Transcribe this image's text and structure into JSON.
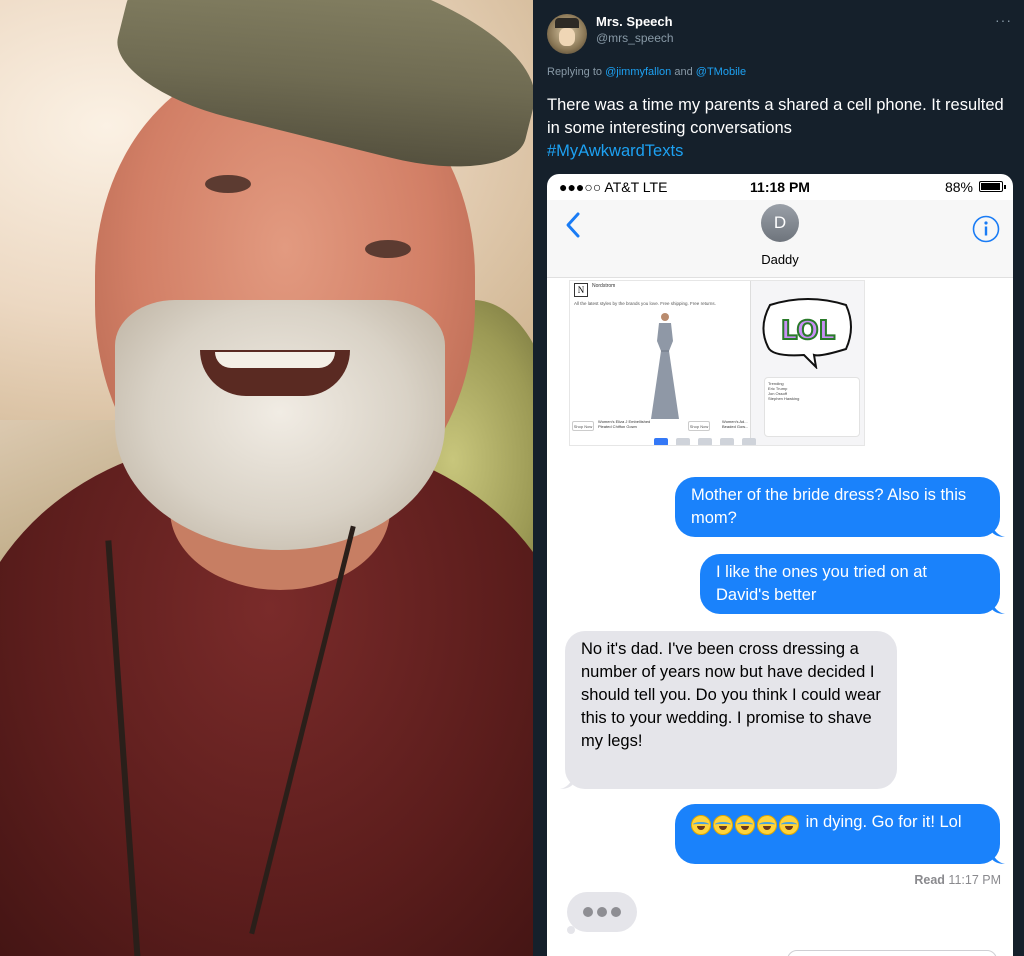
{
  "tweet": {
    "display_name": "Mrs. Speech",
    "handle": "@mrs_speech",
    "more_label": "···",
    "replying_prefix": "Replying to",
    "reply_user_1": "@jimmyfallon",
    "reply_and": "and",
    "reply_user_2": "@TMobile",
    "text": "There was a time my parents a shared a cell phone. It resulted in some interesting conversations",
    "hashtag": "#MyAwkwardTexts"
  },
  "phone": {
    "carrier": "●●●○○ AT&T  LTE",
    "time": "11:18 PM",
    "battery_text": "88%",
    "battery_level": 0.88,
    "contact_initial": "D",
    "contact_name": "Daddy",
    "embed": {
      "store_logo": "N",
      "store_name": "Nordstrom",
      "store_sub": "Sponsored",
      "store_caption": "All the latest styles by the brands you love. Free shipping. Free returns.",
      "item_1": "Women's Eliza J Embellished Pleated Chiffon Gown",
      "item_2": "Women's Ad... Beaded Gow...",
      "shop_now": "Shop Now",
      "badge": "LOL",
      "trending": "Trending",
      "trend_1": "Eric Trump",
      "trend_2": "Jon Ossoff",
      "trend_3": "Stephen Hawking"
    },
    "messages": [
      {
        "from": "me",
        "text": "Mother of the bride dress? Also is this mom?"
      },
      {
        "from": "me",
        "text": "I like the ones you tried on at David's better"
      },
      {
        "from": "them",
        "text": "No it's dad. I've been cross dressing a number of years now but have decided I should tell you. Do you think I could wear this to your wedding. I promise to shave my legs!"
      },
      {
        "from": "me",
        "emoji": "😂😂😂😂😂",
        "text": "in dying. Go for it! Lol"
      }
    ],
    "read_label": "Read",
    "read_time": "11:17 PM"
  },
  "colors": {
    "background": "#15202b",
    "link": "#1da1f2",
    "muted": "#8899a6",
    "imessage_blue": "#1a82fb",
    "imessage_gray": "#e5e5ea"
  }
}
